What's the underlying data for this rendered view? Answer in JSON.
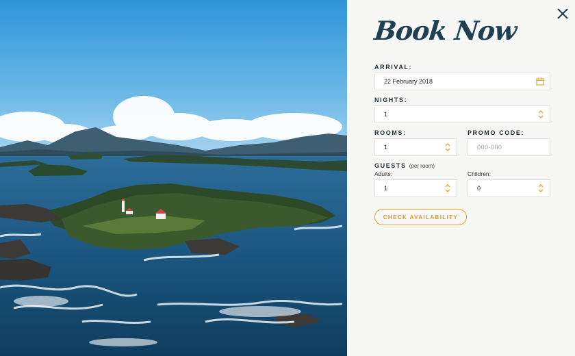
{
  "modal": {
    "title": "Book Now",
    "close_icon": "close-icon"
  },
  "form": {
    "arrival": {
      "label": "ARRIVAL:",
      "value": "22 February 2018",
      "icon": "calendar-icon"
    },
    "nights": {
      "label": "NIGHTS:",
      "value": "1"
    },
    "rooms": {
      "label": "ROOMS:",
      "value": "1"
    },
    "promo": {
      "label": "PROMO CODE:",
      "placeholder": "000-000"
    },
    "guests": {
      "label": "GUESTS",
      "sublabel": "(per room)",
      "adults": {
        "label": "Adults:",
        "value": "1"
      },
      "children": {
        "label": "Children:",
        "value": "0"
      }
    },
    "submit_label": "CHECK AVAILABILITY"
  },
  "colors": {
    "accent": "#e3a22b",
    "title": "#1f3f52",
    "panel_bg": "#f7f7f5"
  }
}
